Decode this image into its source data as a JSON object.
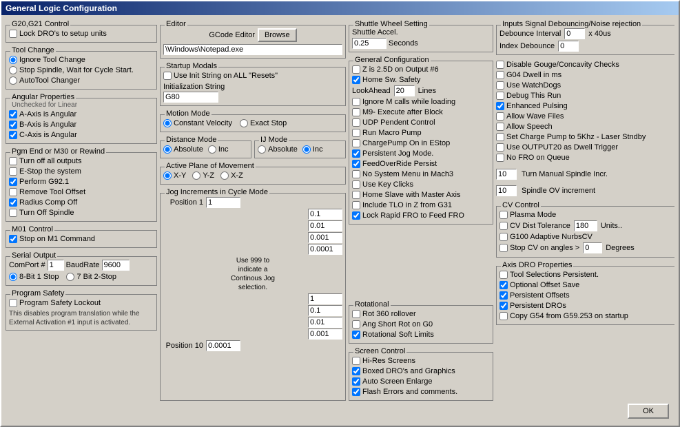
{
  "window": {
    "title": "General Logic Configuration"
  },
  "col1": {
    "g20_g21": {
      "label": "G20,G21 Control",
      "lock_dros": "Lock DRO's to setup units"
    },
    "tool_change": {
      "label": "Tool Change",
      "ignore": "Ignore Tool Change",
      "stop_spindle": "Stop Spindle, Wait for Cycle Start.",
      "auto_tool": "AutoTool Changer"
    },
    "angular": {
      "label": "Angular Properties",
      "unchecked": "Unchecked for Linear",
      "a_axis": "A-Axis is Angular",
      "b_axis": "B-Axis is Angular",
      "c_axis": "C-Axis is Angular"
    },
    "pgm_end": {
      "label": "Pgm End or M30 or Rewind",
      "turn_off": "Turn off all outputs",
      "e_stop": "E-Stop the system",
      "perform_g92": "Perform G92.1",
      "remove_tool": "Remove Tool Offset",
      "radius_comp": "Radius Comp Off",
      "turn_off_spindle": "Turn Off Spindle"
    },
    "m01": {
      "label": "M01 Control",
      "stop_m1": "Stop on M1 Command"
    },
    "serial": {
      "label": "Serial Output",
      "comport_label": "ComPort #",
      "comport_value": "1",
      "baudrate_label": "BaudRate",
      "baudrate_value": "9600",
      "bit1": "8-Bit 1 Stop",
      "bit2": "7 Bit 2-Stop"
    },
    "program_safety": {
      "label": "Program Safety",
      "lockout": "Program Safety Lockout",
      "description": "This disables program translation while the External Activation #1 input is activated."
    }
  },
  "col2": {
    "editor": {
      "label": "Editor",
      "gcode_label": "GCode Editor",
      "browse_btn": "Browse",
      "editor_path": "\\Windows\\Notepad.exe"
    },
    "startup_modals": {
      "label": "Startup Modals",
      "use_init": "Use Init String on ALL  \"Resets\"",
      "init_label": "Initialization String",
      "init_value": "G80"
    },
    "motion_mode": {
      "label": "Motion Mode",
      "constant_velocity": "Constant Velocity",
      "exact_stop": "Exact Stop"
    },
    "distance_mode": {
      "label": "Distance Mode",
      "absolute": "Absolute",
      "inc": "Inc"
    },
    "ij_mode": {
      "label": "IJ Mode",
      "absolute": "Absolute",
      "inc": "Inc"
    },
    "active_plane": {
      "label": "Active Plane of Movement",
      "xy": "X-Y",
      "yz": "Y-Z",
      "xz": "X-Z"
    },
    "jog": {
      "label": "Jog Increments in Cycle Mode",
      "position1_label": "Position 1",
      "position10_label": "Position 10",
      "note": "Use 999 to indicate a Continous Jog selection.",
      "values": [
        "1",
        "0.1",
        "0.01",
        "0.001",
        "0.0001",
        "1",
        "0.1",
        "0.01",
        "0.001",
        "0.0001"
      ]
    }
  },
  "col3": {
    "shuttle": {
      "label": "Shuttle Wheel Setting",
      "accel_label": "Shuttle Accel.",
      "accel_value": "0.25",
      "seconds": "Seconds"
    },
    "general_config": {
      "label": "General Configuration",
      "z_is_2_5d": "Z is 2.5D on Output #6",
      "home_sw": "Home Sw. Safety",
      "lookahead_label": "LookAhead",
      "lookahead_value": "20",
      "lines": "Lines",
      "ignore_m_calls": "Ignore M calls while loading",
      "m9_execute": "M9- Execute after Block",
      "udp_pendent": "UDP Pendent Control",
      "run_macro": "Run Macro Pump",
      "chargepump": "ChargePump On in EStop",
      "persistent_jog": "Persistent Jog Mode.",
      "feedoverride": "FeedOverRide Persist",
      "no_system_menu": "No System Menu in Mach3",
      "use_key_clicks": "Use Key Clicks",
      "home_slave": "Home Slave with Master Axis",
      "include_tlo": "Include TLO in Z from G31",
      "lock_rapid": "Lock Rapid FRO to Feed FRO"
    },
    "rotational": {
      "label": "Rotational",
      "rot360": "Rot 360 rollover",
      "ang_short": "Ang Short Rot on G0",
      "rotational_soft": "Rotational Soft Limits"
    },
    "screen_control": {
      "label": "Screen Control",
      "hi_res": "Hi-Res Screens",
      "boxed_dros": "Boxed DRO's and Graphics",
      "auto_screen": "Auto Screen Enlarge",
      "flash_errors": "Flash Errors and comments."
    }
  },
  "col4": {
    "inputs_signal": {
      "label": "Inputs Signal Debouncing/Noise rejection",
      "debounce_label": "Debounce Interval",
      "debounce_value": "0",
      "x40us": "x 40us",
      "index_label": "Index Debounce",
      "index_value": "0"
    },
    "right_checks": {
      "disable_gouge": "Disable Gouge/Concavity Checks",
      "g04_dwell": "G04 Dwell in ms",
      "use_watchdogs": "Use WatchDogs",
      "debug_this": "Debug This Run",
      "enhanced_pulsing": "Enhanced Pulsing",
      "allow_wave": "Allow Wave Files",
      "allow_speech": "Allow Speech",
      "set_charge_pump": "Set Charge Pump to 5Khz  - Laser Stndby",
      "use_output20": "Use OUTPUT20 as Dwell Trigger",
      "no_fro": "No FRO on Queue"
    },
    "turn_manual": {
      "value": "10",
      "label": "Turn Manual Spindle Incr."
    },
    "spindle_ov": {
      "value": "10",
      "label": "Spindle OV increment"
    },
    "cv_control": {
      "label": "CV Control",
      "plasma_mode": "Plasma Mode",
      "cv_dist_label": "CV Dist Tolerance",
      "cv_dist_value": "180",
      "units": "Units..",
      "g100_adaptive": "G100 Adaptive NurbsCV",
      "stop_cv_label": "Stop CV on angles >",
      "stop_cv_value": "0",
      "degrees": "Degrees"
    },
    "axis_dro": {
      "label": "Axis DRO Properties",
      "tool_selections": "Tool Selections Persistent.",
      "optional_offset": "Optional Offset Save",
      "persistent_offsets": "Persistent Offsets",
      "persistent_dros": "Persistent DROs",
      "copy_g54": "Copy G54 from G59.253 on startup"
    }
  },
  "ok_btn": "OK"
}
